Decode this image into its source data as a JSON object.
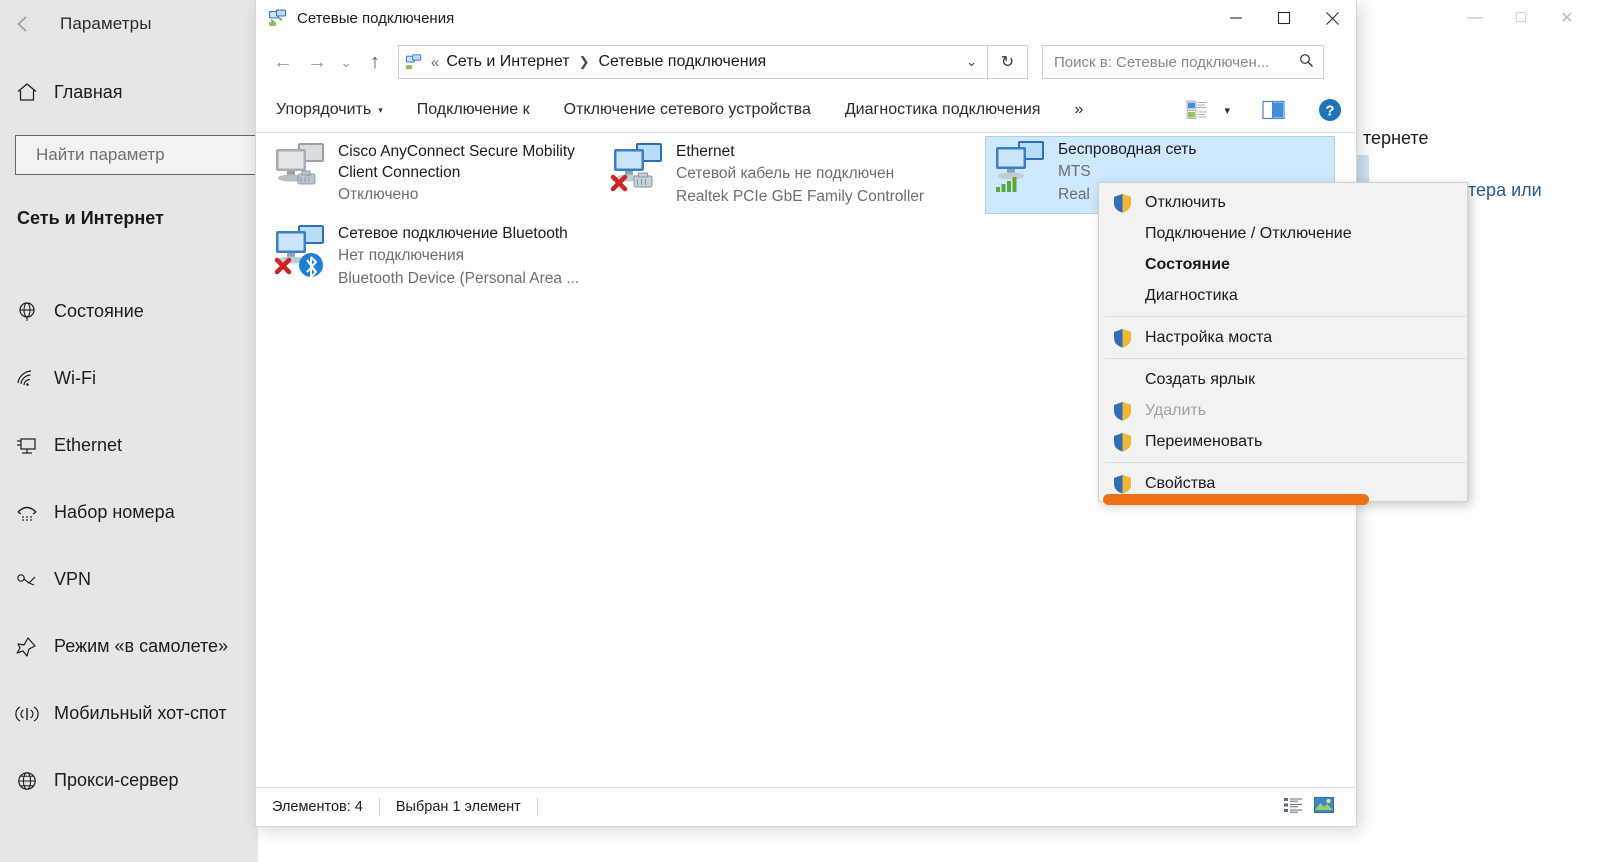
{
  "settings": {
    "back_icon": "back-arrow-icon",
    "title": "Параметры",
    "home": {
      "label": "Главная",
      "icon": "home-icon"
    },
    "search": {
      "placeholder": "Найти параметр",
      "value": ""
    },
    "section_title": "Сеть и Интернет",
    "nav_items": [
      {
        "label": "Состояние",
        "icon": "globe-status-icon"
      },
      {
        "label": "Wi-Fi",
        "icon": "wifi-icon"
      },
      {
        "label": "Ethernet",
        "icon": "ethernet-icon"
      },
      {
        "label": "Набор номера",
        "icon": "dialup-phone-icon"
      },
      {
        "label": "VPN",
        "icon": "vpn-icon"
      },
      {
        "label": "Режим «в самолете»",
        "icon": "airplane-icon"
      },
      {
        "label": "Мобильный хот-спот",
        "icon": "hotspot-icon"
      },
      {
        "label": "Прокси-сервер",
        "icon": "proxy-globe-icon"
      }
    ]
  },
  "background_window": {
    "minimize": "—",
    "maximize": "□",
    "close": "✕",
    "text_fragment_1": "тернете",
    "text_fragment_2": "тера или"
  },
  "explorer": {
    "title": "Сетевые подключения",
    "title_icon": "network-connections-icon",
    "window_controls": {
      "minimize": "—",
      "maximize": "□",
      "close": "✕"
    },
    "nav": {
      "back": "←",
      "forward": "→",
      "recent": "⌄",
      "up": "↑"
    },
    "address": {
      "icon": "network-connections-icon",
      "prefix": "«",
      "crumbs": [
        "Сеть и Интернет",
        "Сетевые подключения"
      ],
      "separator": "❯",
      "dropdown": "⌄",
      "refresh": "↻"
    },
    "search": {
      "placeholder": "Поиск в: Сетевые подключен...",
      "icon": "search-icon"
    },
    "commandbar": {
      "items": [
        {
          "label": "Упорядочить",
          "has_caret": true
        },
        {
          "label": "Подключение к",
          "has_caret": false
        },
        {
          "label": "Отключение сетевого устройства",
          "has_caret": false
        },
        {
          "label": "Диагностика подключения",
          "has_caret": false
        }
      ],
      "overflow": "»",
      "view_icon": "view-layout-icon",
      "view_caret": "▾",
      "preview_pane_icon": "preview-pane-icon",
      "help_icon": "help-icon"
    },
    "connections": [
      {
        "name": "Cisco AnyConnect Secure Mobility",
        "name2": "Client Connection",
        "status": "Отключено",
        "adapter": "",
        "icon": "network-adapter-disabled-icon",
        "selected": false
      },
      {
        "name": "Ethernet",
        "name2": "",
        "status": "Сетевой кабель не подключен",
        "adapter": "Realtek PCIe GbE Family Controller",
        "icon": "network-adapter-unplugged-icon",
        "selected": false
      },
      {
        "name": "Беспроводная сеть",
        "name2": "",
        "status": "MTS",
        "adapter": "Real",
        "icon": "wireless-adapter-icon",
        "selected": true
      },
      {
        "name": "Сетевое подключение Bluetooth",
        "name2": "",
        "status": "Нет подключения",
        "adapter": "Bluetooth Device (Personal Area ...",
        "icon": "bluetooth-adapter-icon",
        "selected": false
      }
    ],
    "statusbar": {
      "count": "Элементов: 4",
      "selection": "Выбран 1 элемент",
      "details_view_icon": "details-view-icon",
      "large_icons_view_icon": "large-icons-view-icon"
    }
  },
  "context_menu": {
    "items": [
      {
        "label": "Отключить",
        "shield": true,
        "bold": false,
        "disabled": false
      },
      {
        "label": "Подключение / Отключение",
        "shield": false,
        "bold": false,
        "disabled": false
      },
      {
        "label": "Состояние",
        "shield": false,
        "bold": true,
        "disabled": false
      },
      {
        "label": "Диагностика",
        "shield": false,
        "bold": false,
        "disabled": false
      },
      {
        "separator": true
      },
      {
        "label": "Настройка моста",
        "shield": true,
        "bold": false,
        "disabled": false
      },
      {
        "separator": true
      },
      {
        "label": "Создать ярлык",
        "shield": false,
        "bold": false,
        "disabled": false
      },
      {
        "label": "Удалить",
        "shield": true,
        "bold": false,
        "disabled": true
      },
      {
        "label": "Переименовать",
        "shield": true,
        "bold": false,
        "disabled": false
      },
      {
        "separator": true
      },
      {
        "label": "Свойства",
        "shield": true,
        "bold": false,
        "disabled": false
      }
    ],
    "highlight_color": "#ee7215"
  }
}
